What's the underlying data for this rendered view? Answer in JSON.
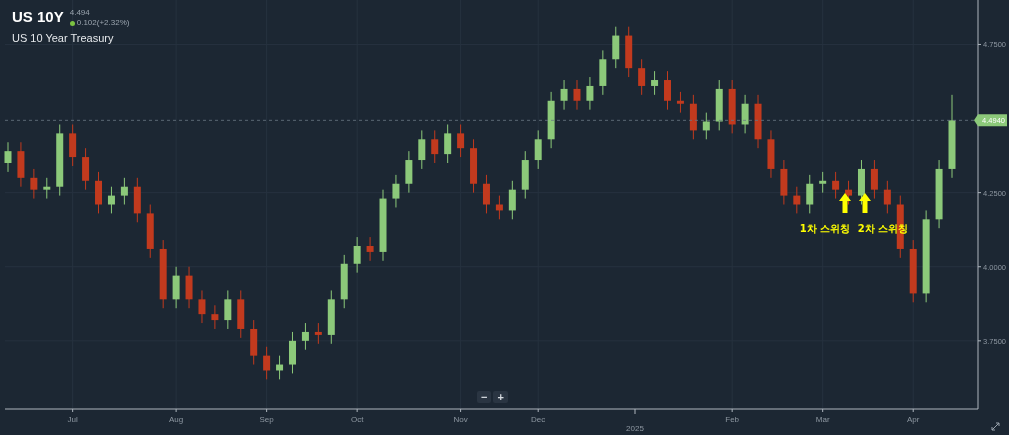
{
  "header": {
    "symbol": "US 10Y",
    "price": "4.494",
    "change": "0.102(+2.32%)",
    "name": "US 10 Year Treasury"
  },
  "chart": {
    "chart_data": {
      "type": "candlestick",
      "grid": true,
      "ylim": [
        3.52,
        4.9
      ],
      "categories": [
        null,
        null,
        null,
        null,
        null,
        "Jul",
        null,
        null,
        null,
        null,
        null,
        null,
        null,
        "Aug",
        null,
        null,
        null,
        null,
        null,
        null,
        "Sep",
        null,
        null,
        null,
        null,
        null,
        null,
        "Oct",
        null,
        null,
        null,
        null,
        null,
        null,
        null,
        "Nov",
        null,
        null,
        null,
        null,
        null,
        "Dec",
        null,
        null,
        null,
        null,
        null,
        null,
        null,
        null,
        null,
        null,
        null,
        null,
        null,
        null,
        "Feb",
        null,
        null,
        null,
        null,
        null,
        null,
        "Mar",
        null,
        null,
        null,
        null,
        null,
        null,
        "Apr",
        null,
        null,
        null
      ],
      "ohlc": [
        [
          4.35,
          4.42,
          4.32,
          4.39
        ],
        [
          4.39,
          4.42,
          4.27,
          4.3
        ],
        [
          4.3,
          4.33,
          4.23,
          4.26
        ],
        [
          4.26,
          4.3,
          4.23,
          4.27
        ],
        [
          4.27,
          4.48,
          4.24,
          4.45
        ],
        [
          4.45,
          4.48,
          4.34,
          4.37
        ],
        [
          4.37,
          4.4,
          4.26,
          4.29
        ],
        [
          4.29,
          4.32,
          4.18,
          4.21
        ],
        [
          4.21,
          4.27,
          4.18,
          4.24
        ],
        [
          4.24,
          4.3,
          4.21,
          4.27
        ],
        [
          4.27,
          4.3,
          4.15,
          4.18
        ],
        [
          4.18,
          4.21,
          4.03,
          4.06
        ],
        [
          4.06,
          4.09,
          3.86,
          3.89
        ],
        [
          3.89,
          4.0,
          3.86,
          3.97
        ],
        [
          3.97,
          4.0,
          3.86,
          3.89
        ],
        [
          3.89,
          3.92,
          3.81,
          3.84
        ],
        [
          3.84,
          3.87,
          3.79,
          3.82
        ],
        [
          3.82,
          3.92,
          3.79,
          3.89
        ],
        [
          3.89,
          3.92,
          3.76,
          3.79
        ],
        [
          3.79,
          3.82,
          3.67,
          3.7
        ],
        [
          3.7,
          3.73,
          3.62,
          3.65
        ],
        [
          3.65,
          3.7,
          3.62,
          3.67
        ],
        [
          3.67,
          3.78,
          3.64,
          3.75
        ],
        [
          3.75,
          3.81,
          3.72,
          3.78
        ],
        [
          3.78,
          3.81,
          3.74,
          3.77
        ],
        [
          3.77,
          3.92,
          3.74,
          3.89
        ],
        [
          3.89,
          4.04,
          3.86,
          4.01
        ],
        [
          4.01,
          4.1,
          3.98,
          4.07
        ],
        [
          4.07,
          4.1,
          4.02,
          4.05
        ],
        [
          4.05,
          4.26,
          4.02,
          4.23
        ],
        [
          4.23,
          4.31,
          4.2,
          4.28
        ],
        [
          4.28,
          4.39,
          4.25,
          4.36
        ],
        [
          4.36,
          4.46,
          4.33,
          4.43
        ],
        [
          4.43,
          4.46,
          4.35,
          4.38
        ],
        [
          4.38,
          4.48,
          4.35,
          4.45
        ],
        [
          4.45,
          4.48,
          4.37,
          4.4
        ],
        [
          4.4,
          4.43,
          4.25,
          4.28
        ],
        [
          4.28,
          4.31,
          4.18,
          4.21
        ],
        [
          4.21,
          4.24,
          4.16,
          4.19
        ],
        [
          4.19,
          4.29,
          4.16,
          4.26
        ],
        [
          4.26,
          4.39,
          4.23,
          4.36
        ],
        [
          4.36,
          4.46,
          4.33,
          4.43
        ],
        [
          4.43,
          4.59,
          4.4,
          4.56
        ],
        [
          4.56,
          4.63,
          4.53,
          4.6
        ],
        [
          4.6,
          4.63,
          4.53,
          4.56
        ],
        [
          4.56,
          4.64,
          4.53,
          4.61
        ],
        [
          4.61,
          4.73,
          4.58,
          4.7
        ],
        [
          4.7,
          4.81,
          4.67,
          4.78
        ],
        [
          4.78,
          4.81,
          4.64,
          4.67
        ],
        [
          4.67,
          4.7,
          4.58,
          4.61
        ],
        [
          4.61,
          4.66,
          4.58,
          4.63
        ],
        [
          4.63,
          4.66,
          4.53,
          4.56
        ],
        [
          4.56,
          4.59,
          4.52,
          4.55
        ],
        [
          4.55,
          4.58,
          4.43,
          4.46
        ],
        [
          4.46,
          4.52,
          4.43,
          4.49
        ],
        [
          4.49,
          4.63,
          4.46,
          4.6
        ],
        [
          4.6,
          4.63,
          4.45,
          4.48
        ],
        [
          4.48,
          4.58,
          4.45,
          4.55
        ],
        [
          4.55,
          4.58,
          4.4,
          4.43
        ],
        [
          4.43,
          4.46,
          4.3,
          4.33
        ],
        [
          4.33,
          4.36,
          4.21,
          4.24
        ],
        [
          4.24,
          4.27,
          4.18,
          4.21
        ],
        [
          4.21,
          4.31,
          4.18,
          4.28
        ],
        [
          4.28,
          4.32,
          4.25,
          4.29
        ],
        [
          4.29,
          4.32,
          4.23,
          4.26
        ],
        [
          4.26,
          4.29,
          4.21,
          4.24
        ],
        [
          4.24,
          4.36,
          4.21,
          4.33
        ],
        [
          4.33,
          4.36,
          4.23,
          4.26
        ],
        [
          4.26,
          4.29,
          4.18,
          4.21
        ],
        [
          4.21,
          4.24,
          4.03,
          4.06
        ],
        [
          4.06,
          4.09,
          3.88,
          3.91
        ],
        [
          3.91,
          4.19,
          3.88,
          4.16
        ],
        [
          4.16,
          4.36,
          4.13,
          4.33
        ],
        [
          4.33,
          4.58,
          4.3,
          4.494
        ]
      ],
      "yticks": [
        {
          "value": 3.75,
          "label": "3.7500"
        },
        {
          "value": 4.0,
          "label": "4.0000"
        },
        {
          "value": 4.25,
          "label": "4.2500"
        },
        {
          "value": 4.75,
          "label": "4.7500"
        }
      ],
      "ref_lines": [
        {
          "axis": "y",
          "value": 4.494,
          "label": "4.4940"
        }
      ],
      "annotations": [
        "1차 스위칭",
        "2차 스위칭"
      ]
    },
    "year_label": "2025"
  },
  "zoom_controls": [
    "−",
    "+"
  ]
}
